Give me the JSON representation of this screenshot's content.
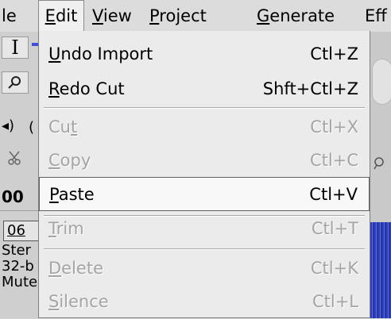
{
  "menubar": [
    {
      "label": "le",
      "mnemonic_index": -1
    },
    {
      "label": "Edit",
      "mnemonic_index": 0
    },
    {
      "label": "View",
      "mnemonic_index": 0
    },
    {
      "label": "Project",
      "mnemonic_index": 0
    },
    {
      "label": "Generate",
      "mnemonic_index": 0
    },
    {
      "label": "Eff",
      "mnemonic_index": -1
    }
  ],
  "edit_menu": {
    "items": [
      {
        "label": "Undo Import",
        "mnemonic_index": 0,
        "accel": "Ctl+Z",
        "enabled": true
      },
      {
        "label": "Redo Cut",
        "mnemonic_index": 0,
        "accel": "Shft+Ctl+Z",
        "enabled": true
      },
      {
        "label": "Cut",
        "mnemonic_index": 2,
        "accel": "Ctl+X",
        "enabled": false
      },
      {
        "label": "Copy",
        "mnemonic_index": 0,
        "accel": "Ctl+C",
        "enabled": false
      },
      {
        "label": "Paste",
        "mnemonic_index": 0,
        "accel": "Ctl+V",
        "enabled": true,
        "highlighted": true
      },
      {
        "label": "Trim",
        "mnemonic_index": 0,
        "accel": "Ctl+T",
        "enabled": false
      },
      {
        "label": "Delete",
        "mnemonic_index": 0,
        "accel": "Ctl+K",
        "enabled": false
      },
      {
        "label": "Silence",
        "mnemonic_index": 0,
        "accel": "Ctl+L",
        "enabled": false
      }
    ]
  },
  "background": {
    "selection_tool_glyph": "I",
    "zoom_icon": "magnifier-icon",
    "speaker_icon": "speaker-icon",
    "speaker_glyph": "◂)",
    "speaker_trail": "(",
    "cut_icon": "scissors-icon",
    "time_text": "00",
    "track_number": "06",
    "track_lines": [
      "Ster",
      "32-b",
      "Mute"
    ]
  },
  "colors": {
    "menu_bg": "#ebebeb",
    "disabled_text": "#a4a4a4",
    "waveform": "#2f3fb8"
  }
}
